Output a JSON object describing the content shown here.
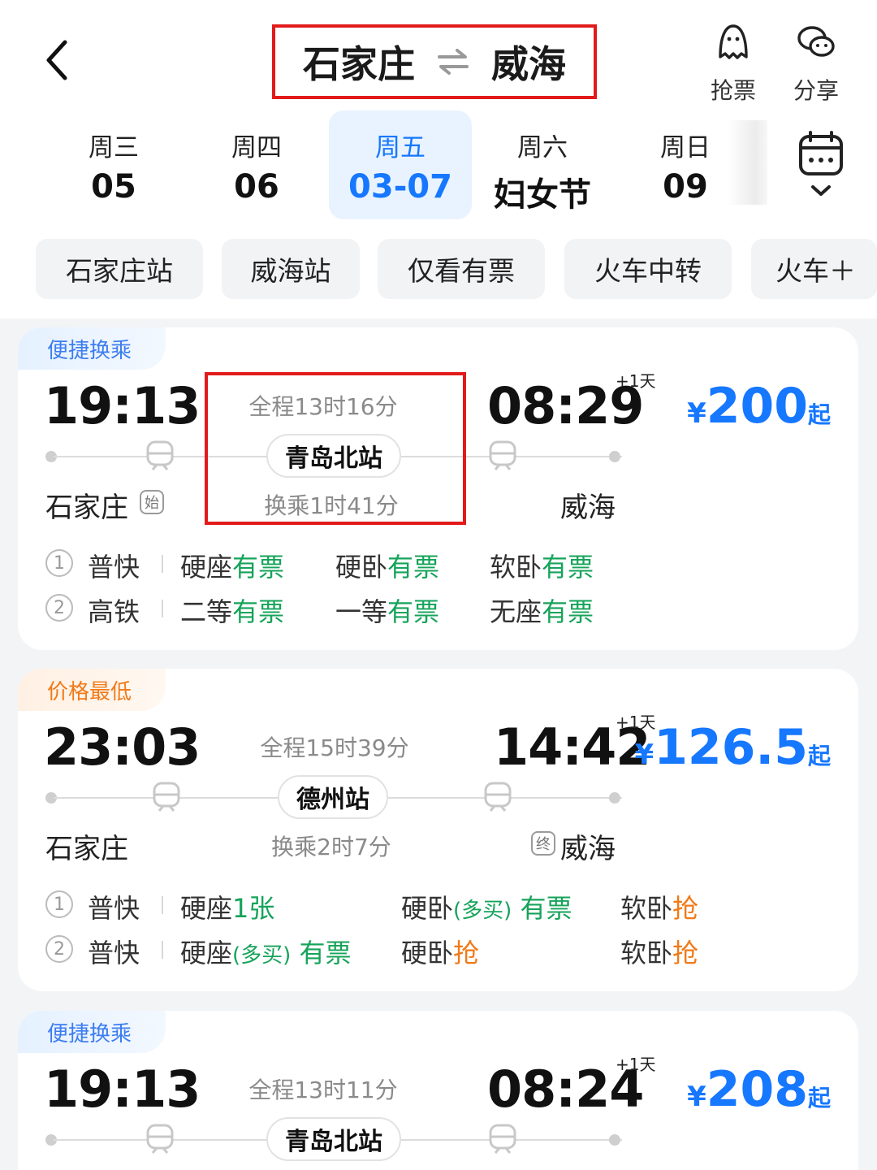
{
  "header": {
    "from_city": "石家庄",
    "to_city": "威海",
    "actions": [
      {
        "label": "抢票",
        "icon": "ghost-icon"
      },
      {
        "label": "分享",
        "icon": "wechat-icon"
      }
    ]
  },
  "dates": [
    {
      "dow": "周三",
      "day": "05",
      "active": false
    },
    {
      "dow": "周四",
      "day": "06",
      "active": false
    },
    {
      "dow": "周五",
      "day": "03-07",
      "active": true
    },
    {
      "dow": "周六",
      "day": "妇女节",
      "active": false
    },
    {
      "dow": "周日",
      "day": "09",
      "active": false
    }
  ],
  "filters": [
    "石家庄站",
    "威海站",
    "仅看有票",
    "火车中转",
    "火车＋"
  ],
  "results": [
    {
      "tag": "便捷换乘",
      "tag_color": "#3c7df0",
      "depart": "19:13",
      "arrive": "08:29",
      "plus_day": "+1天",
      "duration": "全程13时16分",
      "transfer_station": "青岛北站",
      "transfer_wait": "换乘1时41分",
      "from": "石家庄",
      "from_badge": "始",
      "to": "威海",
      "price_symbol": "¥",
      "price": "200",
      "price_suffix": "起",
      "segments": [
        {
          "num": "1",
          "type": "普快",
          "seats": [
            {
              "name": "硬座",
              "status": "有票"
            },
            {
              "name": "硬卧",
              "status": "有票"
            },
            {
              "name": "软卧",
              "status": "有票"
            }
          ]
        },
        {
          "num": "2",
          "type": "高铁",
          "seats": [
            {
              "name": "二等",
              "status": "有票"
            },
            {
              "name": "一等",
              "status": "有票"
            },
            {
              "name": "无座",
              "status": "有票"
            }
          ]
        }
      ]
    },
    {
      "tag": "价格最低",
      "tag_color": "#f07a18",
      "depart": "23:03",
      "arrive": "14:42",
      "plus_day": "+1天",
      "duration": "全程15时39分",
      "transfer_station": "德州站",
      "transfer_wait": "换乘2时7分",
      "from": "石家庄",
      "to": "威海",
      "to_badge": "终",
      "price_symbol": "¥",
      "price": "126.5",
      "price_suffix": "起",
      "segments": [
        {
          "num": "1",
          "type": "普快",
          "seats": [
            {
              "name": "硬座",
              "status": "1张"
            },
            {
              "name": "硬卧",
              "note": "(多买)",
              "status": "有票"
            },
            {
              "name": "软卧",
              "status": "抢"
            }
          ]
        },
        {
          "num": "2",
          "type": "普快",
          "seats": [
            {
              "name": "硬座",
              "note": "(多买)",
              "status": "有票"
            },
            {
              "name": "硬卧",
              "status": "抢"
            },
            {
              "name": "软卧",
              "status": "抢"
            }
          ]
        }
      ]
    },
    {
      "tag": "便捷换乘",
      "tag_color": "#3c7df0",
      "depart": "19:13",
      "arrive": "08:24",
      "plus_day": "+1天",
      "duration": "全程13时11分",
      "transfer_station": "青岛北站",
      "price_symbol": "¥",
      "price": "208",
      "price_suffix": "起"
    }
  ]
}
